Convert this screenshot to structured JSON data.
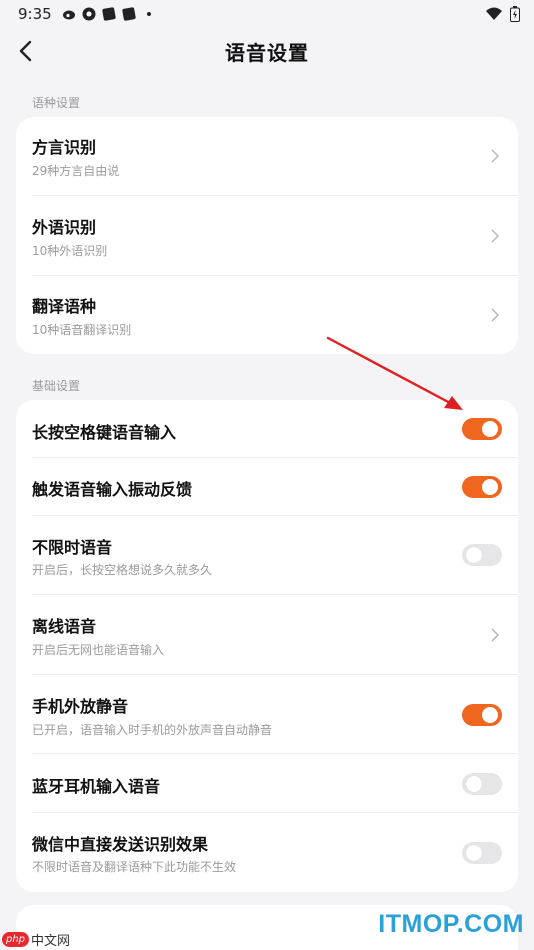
{
  "status_bar": {
    "time": "9:35"
  },
  "header": {
    "title": "语音设置"
  },
  "language_section": {
    "label": "语种设置",
    "items": [
      {
        "title": "方言识别",
        "subtitle": "29种方言自由说"
      },
      {
        "title": "外语识别",
        "subtitle": "10种外语识别"
      },
      {
        "title": "翻译语种",
        "subtitle": "10种语音翻译识别"
      }
    ]
  },
  "basic_section": {
    "label": "基础设置",
    "items": [
      {
        "title": "长按空格键语音输入",
        "subtitle": "",
        "control": "toggle",
        "on": true
      },
      {
        "title": "触发语音输入振动反馈",
        "subtitle": "",
        "control": "toggle",
        "on": true
      },
      {
        "title": "不限时语音",
        "subtitle": "开启后，长按空格想说多久就多久",
        "control": "toggle",
        "on": false
      },
      {
        "title": "离线语音",
        "subtitle": "开启后无网也能语音输入",
        "control": "chevron"
      },
      {
        "title": "手机外放静音",
        "subtitle": "已开启，语音输入时手机的外放声音自动静音",
        "control": "toggle",
        "on": true
      },
      {
        "title": "蓝牙耳机输入语音",
        "subtitle": "",
        "control": "toggle",
        "on": false
      },
      {
        "title": "微信中直接发送识别效果",
        "subtitle": "不限时语音及翻译语种下此功能不生效",
        "control": "toggle",
        "on": false
      }
    ]
  },
  "colors": {
    "accent": "#f0661e",
    "toggle_off": "#e6e6e9",
    "annotation_arrow": "#e02020"
  },
  "watermarks": {
    "php": "php",
    "php_cn": "中文网",
    "itmop": "ITMOP.COM"
  }
}
